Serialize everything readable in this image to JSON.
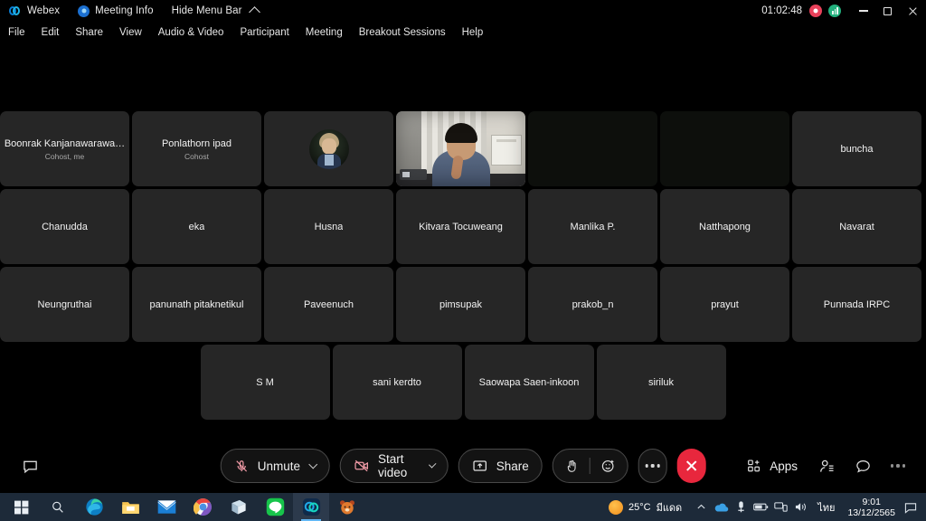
{
  "titlebar": {
    "app_name": "Webex",
    "meeting_info": "Meeting Info",
    "hide_menu_bar": "Hide Menu Bar",
    "timer": "01:02:48",
    "recording_icon": "record-indicator-icon",
    "signal_icon": "network-signal-icon",
    "minimize": "minimize-button",
    "maximize": "maximize-button",
    "close": "close-button"
  },
  "menubar": {
    "items": [
      {
        "label": "File"
      },
      {
        "label": "Edit"
      },
      {
        "label": "Share"
      },
      {
        "label": "View"
      },
      {
        "label": "Audio & Video"
      },
      {
        "label": "Participant"
      },
      {
        "label": "Meeting"
      },
      {
        "label": "Breakout Sessions"
      },
      {
        "label": "Help"
      }
    ]
  },
  "grid": {
    "rows": [
      [
        {
          "name": "Boonrak Kanjanawarawa…",
          "role": "Cohost, me",
          "kind": "name"
        },
        {
          "name": "Ponlathorn ipad",
          "role": "Cohost",
          "kind": "name"
        },
        {
          "name": "",
          "role": "",
          "kind": "avatar"
        },
        {
          "name": "",
          "role": "",
          "kind": "video"
        },
        {
          "name": "",
          "role": "",
          "kind": "dark"
        },
        {
          "name": "",
          "role": "",
          "kind": "dark"
        },
        {
          "name": "buncha",
          "role": "",
          "kind": "name"
        }
      ],
      [
        {
          "name": "Chanudda",
          "role": "",
          "kind": "name"
        },
        {
          "name": "eka",
          "role": "",
          "kind": "name"
        },
        {
          "name": "Husna",
          "role": "",
          "kind": "name"
        },
        {
          "name": "Kitvara Tocuweang",
          "role": "",
          "kind": "name"
        },
        {
          "name": "Manlika P.",
          "role": "",
          "kind": "name"
        },
        {
          "name": "Natthapong",
          "role": "",
          "kind": "name"
        },
        {
          "name": "Navarat",
          "role": "",
          "kind": "name"
        }
      ],
      [
        {
          "name": "Neungruthai",
          "role": "",
          "kind": "name"
        },
        {
          "name": "panunath pitaknetikul",
          "role": "",
          "kind": "name"
        },
        {
          "name": "Paveenuch",
          "role": "",
          "kind": "name"
        },
        {
          "name": "pimsupak",
          "role": "",
          "kind": "name"
        },
        {
          "name": "prakob_n",
          "role": "",
          "kind": "name"
        },
        {
          "name": "prayut",
          "role": "",
          "kind": "name"
        },
        {
          "name": "Punnada IRPC",
          "role": "",
          "kind": "name"
        }
      ],
      [
        {
          "name": "S M",
          "role": "",
          "kind": "name"
        },
        {
          "name": "sani kerdto",
          "role": "",
          "kind": "name"
        },
        {
          "name": "Saowapa Saen-inkoon",
          "role": "",
          "kind": "name"
        },
        {
          "name": "siriluk",
          "role": "",
          "kind": "name"
        }
      ]
    ]
  },
  "controls": {
    "chat_bubble_icon": "chat-bubble-icon",
    "mute_label": "Unmute",
    "mute_icon": "microphone-muted-icon",
    "video_label": "Start video",
    "video_icon": "camera-off-icon",
    "share_label": "Share",
    "share_icon": "share-screen-icon",
    "reaction_hand_icon": "raise-hand-icon",
    "reaction_emoji_icon": "emoji-reaction-icon",
    "more_icon": "more-options-icon",
    "leave_icon": "leave-meeting-icon",
    "apps_label": "Apps",
    "apps_icon": "apps-grid-icon",
    "participants_icon": "participants-icon",
    "panel_chat_icon": "chat-panel-icon",
    "panel_more_icon": "more-panels-icon",
    "accent_red": "#e8273d"
  },
  "taskbar": {
    "start_icon": "windows-start-icon",
    "search_icon": "search-icon",
    "apps": [
      {
        "icon": "edge-browser-icon"
      },
      {
        "icon": "file-explorer-icon"
      },
      {
        "icon": "mail-icon"
      },
      {
        "icon": "chrome-browser-icon"
      },
      {
        "icon": "microsoft-store-icon"
      },
      {
        "icon": "line-app-icon"
      },
      {
        "icon": "webex-app-icon"
      },
      {
        "icon": "bear-app-icon"
      }
    ],
    "weather_temp": "25°C",
    "weather_desc": "มีแดด",
    "weather_icon": "sun-icon",
    "tray": [
      {
        "icon": "show-hidden-icons-chevron"
      },
      {
        "icon": "onedrive-icon"
      },
      {
        "icon": "usb-device-icon"
      },
      {
        "icon": "battery-icon"
      },
      {
        "icon": "network-icon"
      },
      {
        "icon": "volume-icon"
      }
    ],
    "language": "ไทย",
    "time": "9:01",
    "date": "13/12/2565",
    "notification_icon": "notification-center-icon"
  }
}
